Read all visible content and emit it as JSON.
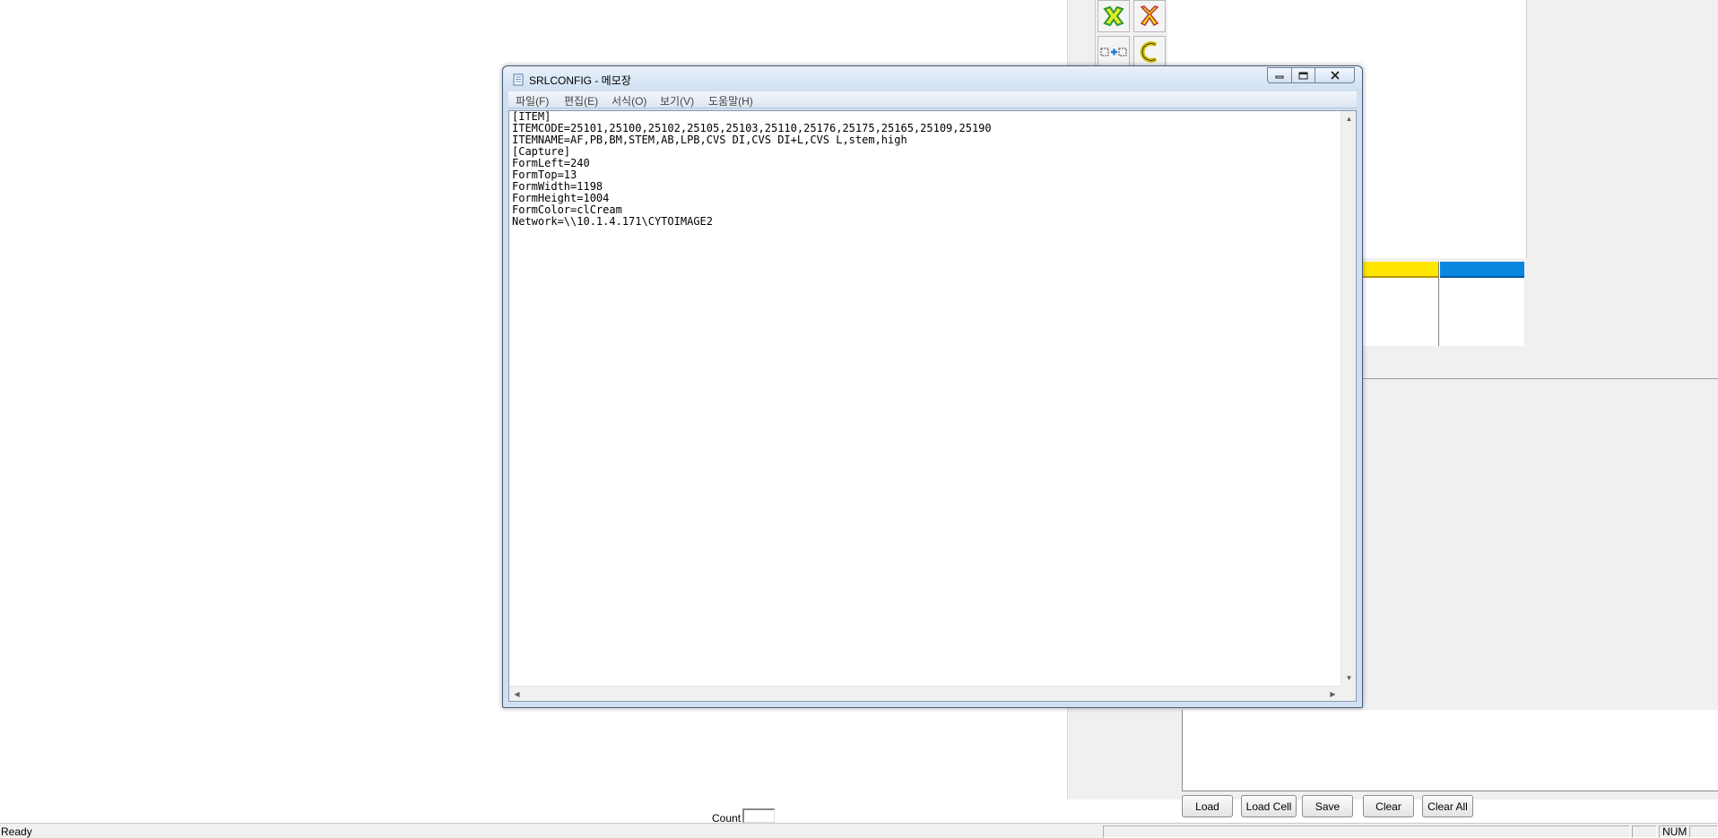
{
  "notepad": {
    "title": "SRLCONFIG - 메모장",
    "menu": [
      "파일(F)",
      "편집(E)",
      "서식(O)",
      "보기(V)",
      "도움말(H)"
    ],
    "content": "[ITEM]\nITEMCODE=25101,25100,25102,25105,25103,25110,25176,25175,25165,25109,25190\nITEMNAME=AF,PB,BM,STEM,AB,LPB,CVS DI,CVS DI+L,CVS L,stem,high\n[Capture]\nFormLeft=240\nFormTop=13\nFormWidth=1198\nFormHeight=1004\nFormColor=clCream\nNetwork=\\\\10.1.4.171\\CYTOIMAGE2"
  },
  "buttons": {
    "load": "Load",
    "load_cell": "Load Cell",
    "save": "Save",
    "clear": "Clear",
    "clear_all": "Clear All"
  },
  "count_label": "Count",
  "status": {
    "ready": "Ready",
    "num": "NUM"
  },
  "colors": {
    "yellow_bar": "#ffe600",
    "blue_bar": "#0a86e0",
    "title_bar": "#cfe0f2"
  },
  "icons": [
    "cross-icon",
    "scissors-icon",
    "cell-add-icon",
    "c-shape-icon",
    "minimize-icon",
    "maximize-icon",
    "close-icon",
    "notepad-icon"
  ]
}
